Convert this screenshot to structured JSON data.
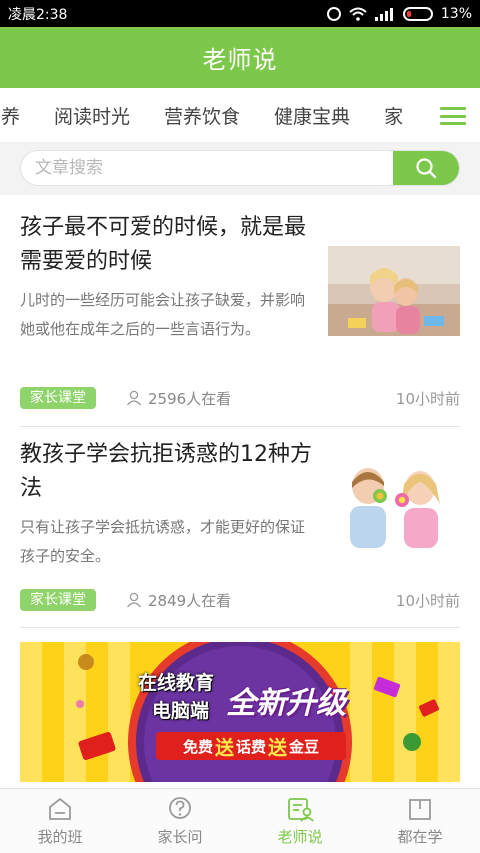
{
  "status_bar": {
    "time": "凌晨2:38",
    "battery": "13%"
  },
  "app": {
    "title": "老师说"
  },
  "tabs": [
    "营养",
    "阅读时光",
    "营养饮食",
    "健康宝典",
    "家"
  ],
  "search": {
    "placeholder": "文章搜索"
  },
  "articles": [
    {
      "title": "孩子最不可爱的时候，就是最需要爱的时候",
      "description": "儿时的一些经历可能会让孩子缺爱，并影响她或他在成年之后的一些言语行为。",
      "tag": "家长课堂",
      "views": "2596人在看",
      "time": "10小时前"
    },
    {
      "title": "教孩子学会抗拒诱惑的12种方法",
      "description": "只有让孩子学会抵抗诱惑，才能更好的保证孩子的安全。",
      "tag": "家长课堂",
      "views": "2849人在看",
      "time": "10小时前"
    }
  ],
  "banner": {
    "line1": "在线教育",
    "line2": "电脑端",
    "headline": "全新升级",
    "promo_free": "免费",
    "promo_send1": "送",
    "promo_item1": "话费",
    "promo_send2": "送",
    "promo_item2": "金豆"
  },
  "bottom_nav": [
    {
      "label": "我的班",
      "icon": "home-icon",
      "active": false
    },
    {
      "label": "家长问",
      "icon": "question-icon",
      "active": false
    },
    {
      "label": "老师说",
      "icon": "teacher-icon",
      "active": true
    },
    {
      "label": "都在学",
      "icon": "book-icon",
      "active": false
    }
  ],
  "colors": {
    "accent": "#7cc84a",
    "tag": "#8fd46a",
    "banner_bg": "#ffd21a",
    "banner_circle": "#5b2a8c"
  }
}
